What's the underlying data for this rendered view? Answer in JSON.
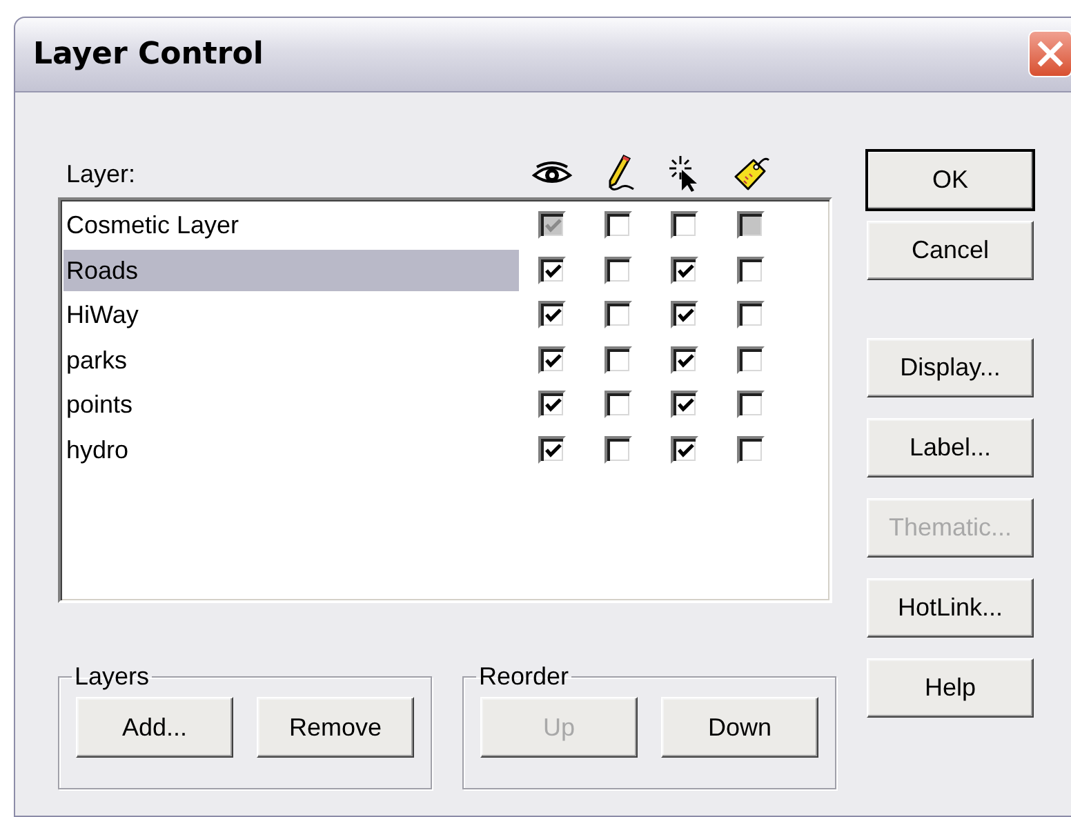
{
  "window": {
    "title": "Layer Control"
  },
  "layer_label": {
    "text": "Layer:"
  },
  "layers": [
    {
      "name": "Cosmetic Layer",
      "selected": false,
      "visible": {
        "checked": true,
        "disabled": true
      },
      "editable": {
        "checked": false,
        "disabled": false
      },
      "selectable": {
        "checked": false,
        "disabled": false
      },
      "labeled": {
        "checked": false,
        "disabled": true
      }
    },
    {
      "name": "Roads",
      "selected": true,
      "visible": {
        "checked": true,
        "disabled": false
      },
      "editable": {
        "checked": false,
        "disabled": false
      },
      "selectable": {
        "checked": true,
        "disabled": false
      },
      "labeled": {
        "checked": false,
        "disabled": false
      }
    },
    {
      "name": "HiWay",
      "selected": false,
      "visible": {
        "checked": true,
        "disabled": false
      },
      "editable": {
        "checked": false,
        "disabled": false
      },
      "selectable": {
        "checked": true,
        "disabled": false
      },
      "labeled": {
        "checked": false,
        "disabled": false
      }
    },
    {
      "name": "parks",
      "selected": false,
      "visible": {
        "checked": true,
        "disabled": false
      },
      "editable": {
        "checked": false,
        "disabled": false
      },
      "selectable": {
        "checked": true,
        "disabled": false
      },
      "labeled": {
        "checked": false,
        "disabled": false
      }
    },
    {
      "name": "points",
      "selected": false,
      "visible": {
        "checked": true,
        "disabled": false
      },
      "editable": {
        "checked": false,
        "disabled": false
      },
      "selectable": {
        "checked": true,
        "disabled": false
      },
      "labeled": {
        "checked": false,
        "disabled": false
      }
    },
    {
      "name": "hydro",
      "selected": false,
      "visible": {
        "checked": true,
        "disabled": false
      },
      "editable": {
        "checked": false,
        "disabled": false
      },
      "selectable": {
        "checked": true,
        "disabled": false
      },
      "labeled": {
        "checked": false,
        "disabled": false
      }
    }
  ],
  "groups": [
    {
      "title": "Layers",
      "buttons": [
        {
          "label": "Add...",
          "disabled": false
        },
        {
          "label": "Remove",
          "disabled": false
        }
      ]
    },
    {
      "title": "Reorder",
      "buttons": [
        {
          "label": "Up",
          "disabled": true
        },
        {
          "label": "Down",
          "disabled": false
        }
      ]
    }
  ],
  "side_buttons": [
    {
      "label": "OK",
      "default": true,
      "disabled": false
    },
    {
      "label": "Cancel",
      "default": false,
      "disabled": false
    },
    {
      "label": "Display...",
      "default": false,
      "disabled": false
    },
    {
      "label": "Label...",
      "default": false,
      "disabled": false
    },
    {
      "label": "Thematic...",
      "default": false,
      "disabled": true
    },
    {
      "label": "HotLink...",
      "default": false,
      "disabled": false
    },
    {
      "label": "Help",
      "default": false,
      "disabled": false
    }
  ]
}
